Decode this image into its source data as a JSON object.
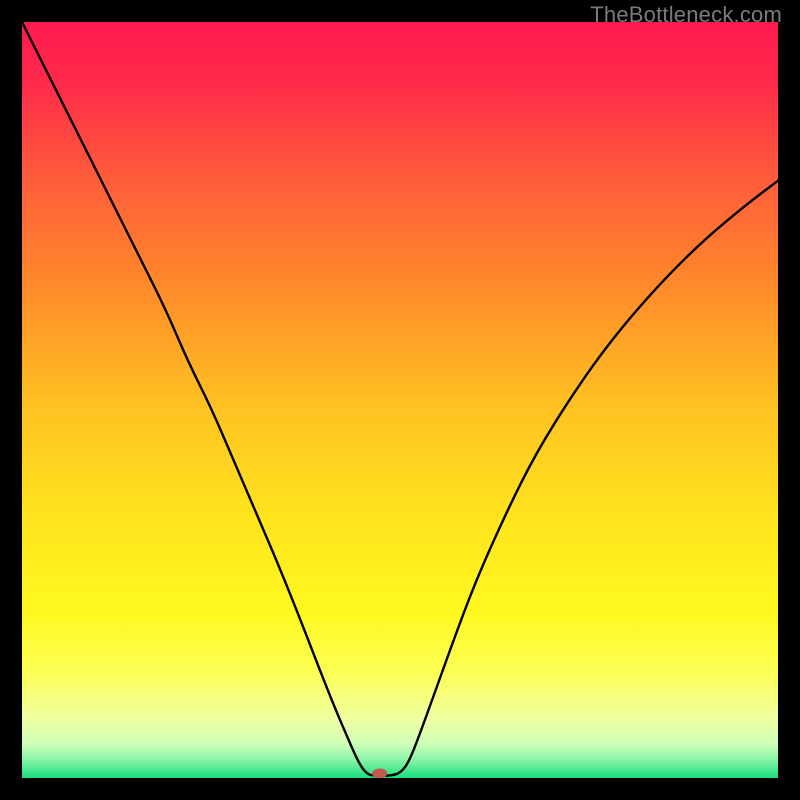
{
  "watermark": "TheBottleneck.com",
  "chart_data": {
    "type": "line",
    "title": "",
    "xlabel": "",
    "ylabel": "",
    "xlim": [
      0,
      100
    ],
    "ylim": [
      0,
      100
    ],
    "background_gradient": {
      "stops": [
        {
          "offset": 0.0,
          "color": "#ff1a50"
        },
        {
          "offset": 0.08,
          "color": "#ff2a4a"
        },
        {
          "offset": 0.2,
          "color": "#ff5a3c"
        },
        {
          "offset": 0.35,
          "color": "#ff8a2a"
        },
        {
          "offset": 0.5,
          "color": "#ffbf22"
        },
        {
          "offset": 0.65,
          "color": "#ffe31e"
        },
        {
          "offset": 0.78,
          "color": "#fff81f"
        },
        {
          "offset": 0.86,
          "color": "#fcff55"
        },
        {
          "offset": 0.92,
          "color": "#f1ffa0"
        },
        {
          "offset": 0.955,
          "color": "#cfffb8"
        },
        {
          "offset": 0.975,
          "color": "#8cf5a8"
        },
        {
          "offset": 1.0,
          "color": "#19e07e"
        }
      ]
    },
    "series": [
      {
        "name": "bottleneck-curve",
        "x": [
          0,
          2,
          4,
          7,
          10,
          13,
          16,
          19,
          22,
          25,
          28,
          31,
          34,
          37,
          39.5,
          41.5,
          43,
          44,
          44.8,
          45.5,
          46.2,
          49,
          50.2,
          51.2,
          52.5,
          54.5,
          57,
          60,
          64,
          68,
          73,
          78,
          84,
          90,
          96,
          100
        ],
        "y": [
          100,
          96,
          92,
          86,
          80,
          74,
          68,
          62,
          55,
          49,
          42,
          35,
          28,
          20.5,
          14,
          9,
          5.5,
          3.2,
          1.6,
          0.7,
          0.3,
          0.3,
          0.8,
          2.2,
          5.5,
          11,
          18,
          26,
          35,
          43,
          51,
          58,
          65,
          71,
          76,
          79
        ]
      }
    ],
    "marker": {
      "name": "bottleneck-min-marker",
      "x": 47.3,
      "y": 0.6,
      "color": "#c25b4d",
      "rx": 7.5,
      "ry": 5
    }
  }
}
